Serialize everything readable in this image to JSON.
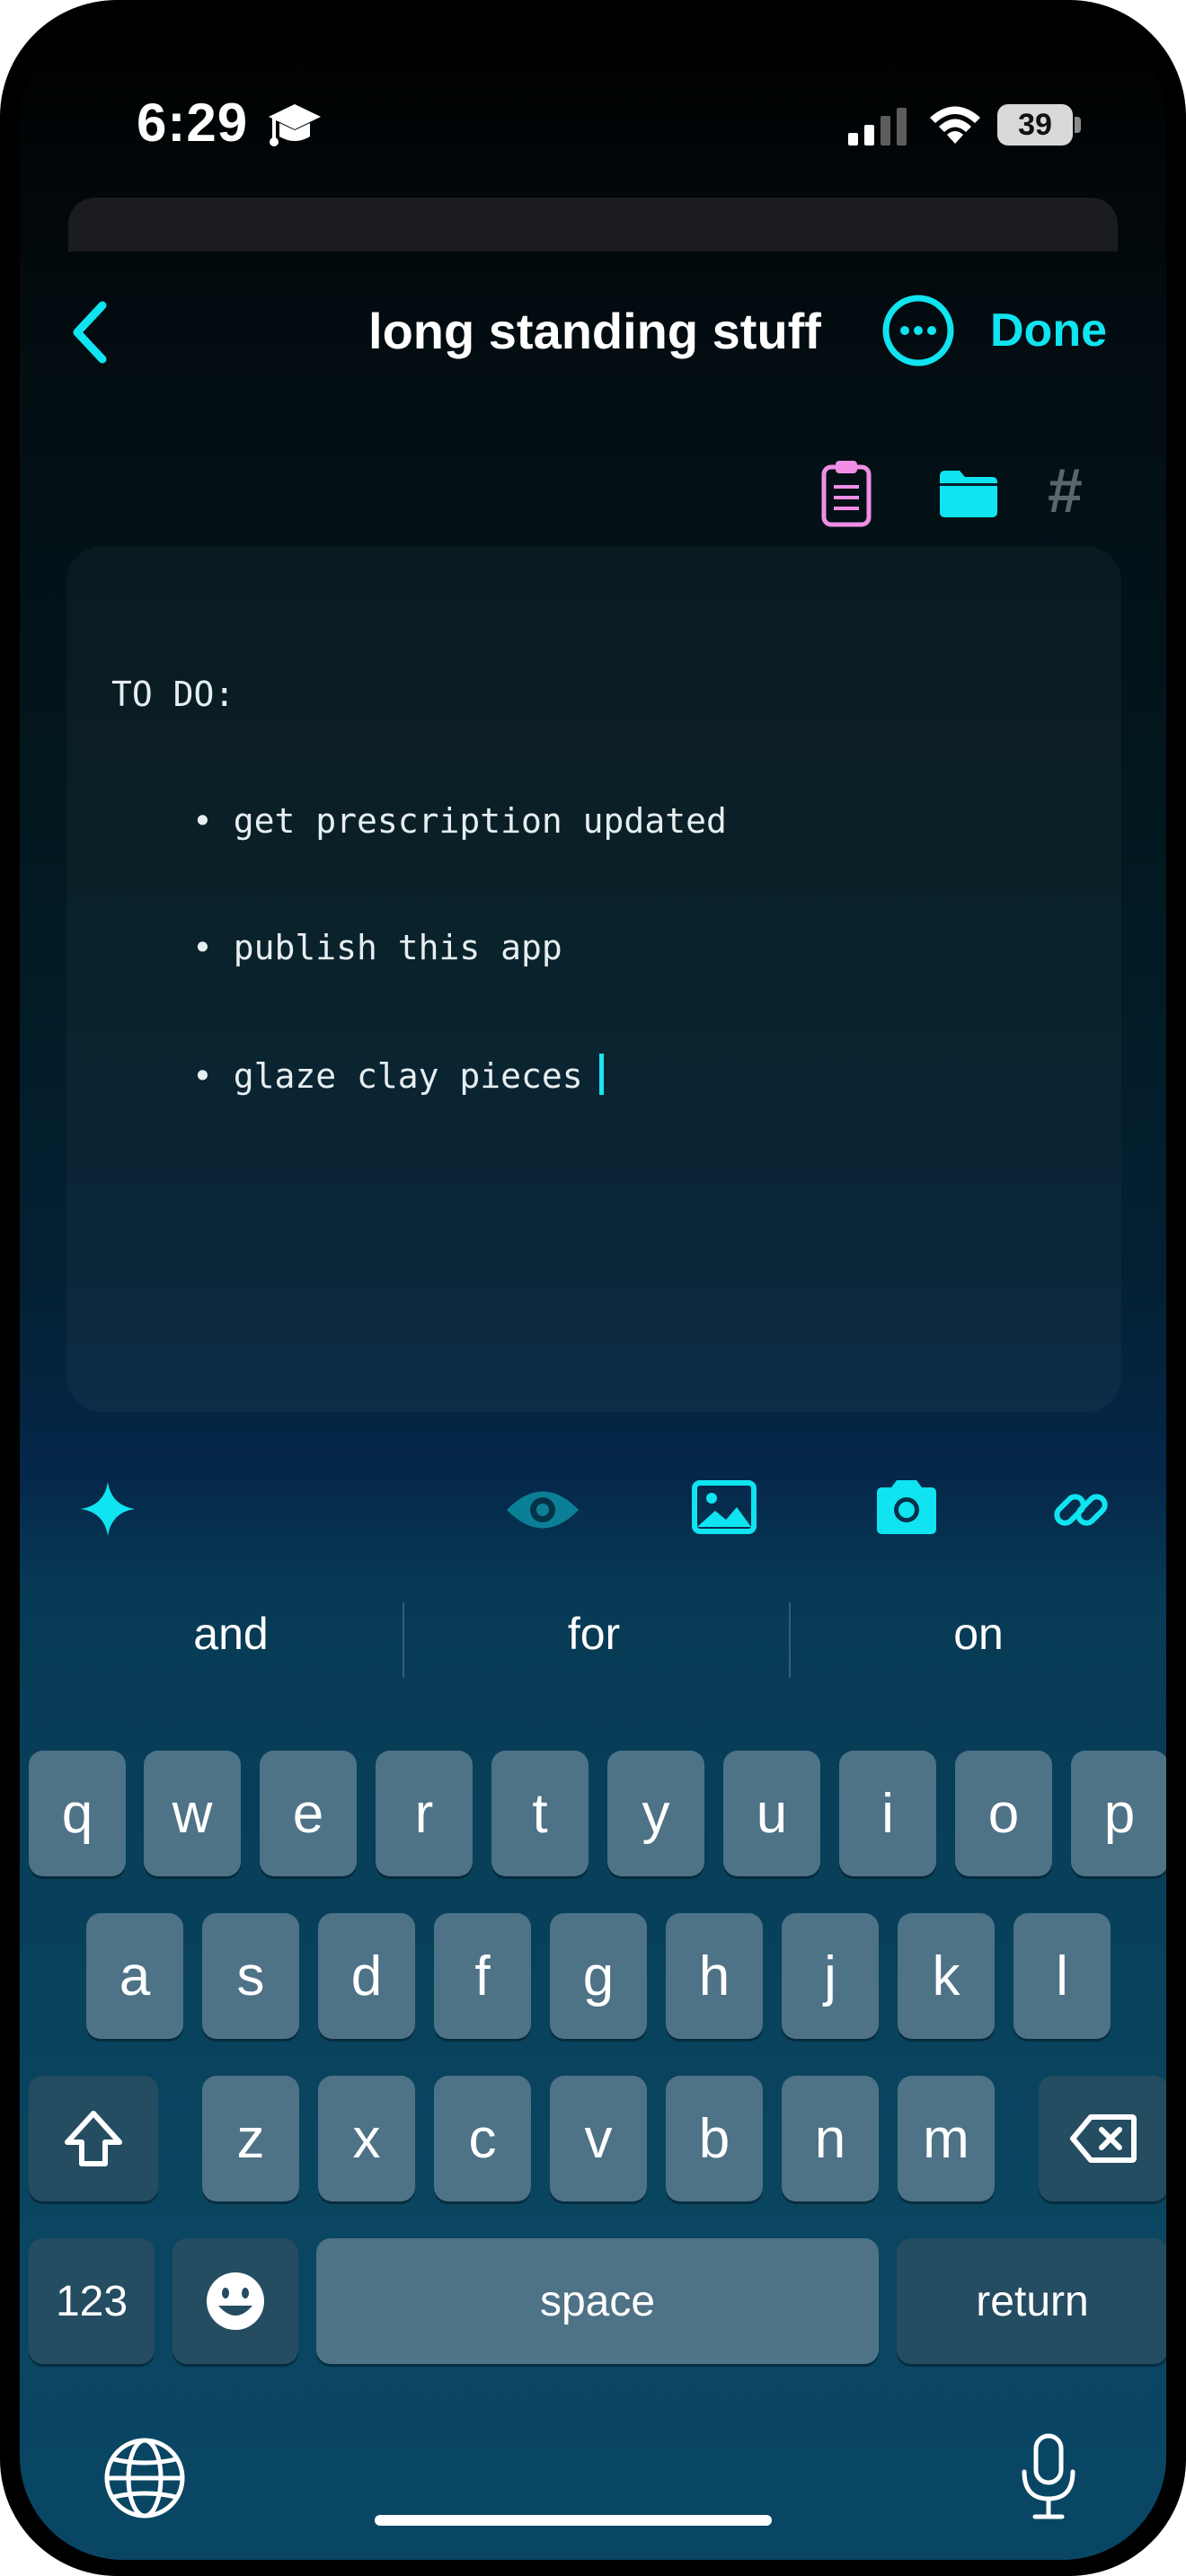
{
  "status_bar": {
    "time": "6:29",
    "battery": "39",
    "status_icons": [
      "graduation-cap-icon",
      "cellular-signal-icon",
      "wifi-icon",
      "battery-icon"
    ]
  },
  "nav": {
    "title": "long standing stuff",
    "done_label": "Done",
    "back_icon": "chevron-left-icon",
    "more_icon": "ellipsis-circle-icon"
  },
  "note_tools": {
    "icons": [
      "clipboard-icon",
      "folder-icon",
      "hashtag-icon"
    ],
    "hash_glyph": "#"
  },
  "editor": {
    "heading": "TO DO:",
    "items": [
      "• get prescription updated",
      "• publish this app",
      "• glaze clay pieces"
    ]
  },
  "format_bar": {
    "icons": [
      "sparkle-icon",
      "eye-icon",
      "photo-icon",
      "camera-icon",
      "link-icon"
    ]
  },
  "keyboard": {
    "suggestions": [
      "and",
      "for",
      "on"
    ],
    "row1": [
      "q",
      "w",
      "e",
      "r",
      "t",
      "y",
      "u",
      "i",
      "o",
      "p"
    ],
    "row2": [
      "a",
      "s",
      "d",
      "f",
      "g",
      "h",
      "j",
      "k",
      "l"
    ],
    "row3": [
      "z",
      "x",
      "c",
      "v",
      "b",
      "n",
      "m"
    ],
    "numbers_label": "123",
    "space_label": "space",
    "return_label": "return"
  },
  "colors": {
    "accent": "#0FE4F0",
    "clipboard": "#F08EE6",
    "key": "#4E7286",
    "key_dark": "#244D62"
  }
}
